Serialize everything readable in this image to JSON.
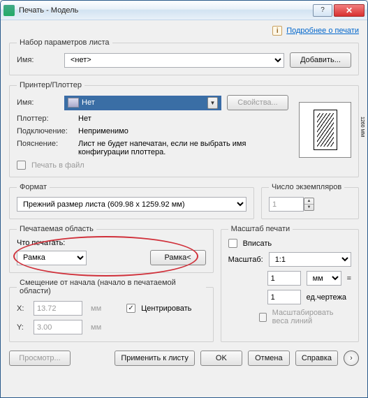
{
  "title": "Печать - Модель",
  "help_link": "Подробнее о печати",
  "page_setup": {
    "legend": "Набор параметров листа",
    "name_label": "Имя:",
    "name_value": "<нет>",
    "add_button": "Добавить..."
  },
  "printer": {
    "legend": "Принтер/Плоттер",
    "name_label": "Имя:",
    "selected_plotter": "Нет",
    "props_button": "Свойства...",
    "plotter_label": "Плоттер:",
    "plotter_value": "Нет",
    "connection_label": "Подключение:",
    "connection_value": "Неприменимо",
    "explanation_label": "Пояснение:",
    "explanation_value": "Лист не будет напечатан, если не выбрать имя конфигурации плоттера.",
    "to_file_label": "Печать в файл",
    "preview_dim": "1260 MM"
  },
  "format": {
    "legend": "Формат",
    "value": "Прежний размер листа (609.98 x 1259.92 мм)"
  },
  "copies": {
    "legend": "Число экземпляров",
    "value": "1"
  },
  "print_area": {
    "legend": "Печатаемая область",
    "what_label": "Что печатать:",
    "what_value": "Рамка",
    "window_button": "Рамка<"
  },
  "scale": {
    "legend": "Масштаб печати",
    "fit_label": "Вписать",
    "scale_label": "Масштаб:",
    "scale_value": "1:1",
    "input1": "1",
    "unit_value": "мм",
    "equals": "=",
    "input2": "1",
    "drawing_units": "ед.чертежа",
    "scale_weights": "Масштабировать веса линий"
  },
  "offset": {
    "legend": "Смещение от начала (начало в печатаемой области)",
    "x_label": "X:",
    "x_value": "13.72",
    "y_label": "Y:",
    "y_value": "3.00",
    "unit": "мм",
    "center_label": "Центрировать"
  },
  "buttons": {
    "preview": "Просмотр...",
    "apply": "Применить к листу",
    "ok": "OK",
    "cancel": "Отмена",
    "help": "Справка"
  }
}
